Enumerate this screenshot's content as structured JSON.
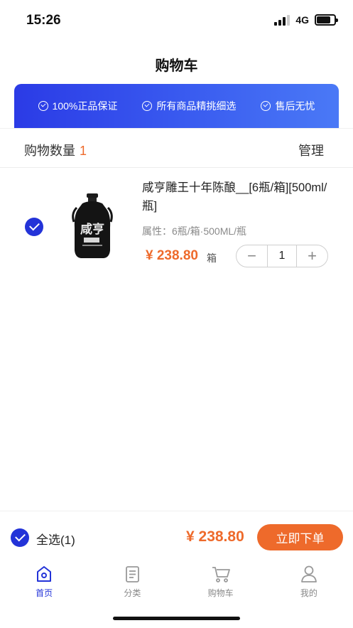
{
  "status_bar": {
    "time": "15:26",
    "network": "4G",
    "battery_level": 0.8
  },
  "header": {
    "title": "购物车"
  },
  "promo": {
    "items": [
      {
        "label": "100%正品保证",
        "icon": "check-circle-icon"
      },
      {
        "label": "所有商品精挑细选",
        "icon": "check-circle-icon"
      },
      {
        "label": "售后无忧",
        "icon": "check-circle-icon"
      }
    ],
    "colors": {
      "start": "#2b3be6",
      "end": "#4a79f6"
    }
  },
  "cart": {
    "count_label": "购物数量",
    "count": "1",
    "manage_label": "管理"
  },
  "items": [
    {
      "selected": true,
      "title": "咸亨雕王十年陈酿__[6瓶/箱][500ml/瓶]",
      "attributes": "属性：6瓶/箱·500ML/瓶",
      "price": "¥ 238.80",
      "unit": "箱",
      "quantity": "1",
      "minus_symbol": "−",
      "plus_symbol": "+",
      "image_lettering": "咸亨"
    }
  ],
  "checkout": {
    "select_all_label": "全选(1)",
    "total": "¥ 238.80",
    "order_button": "立即下单"
  },
  "tabbar": {
    "tabs": [
      {
        "label": "首页",
        "icon": "home-icon",
        "active": true
      },
      {
        "label": "分类",
        "icon": "category-list-icon",
        "active": false
      },
      {
        "label": "购物车",
        "icon": "shopping-cart-icon",
        "active": false
      },
      {
        "label": "我的",
        "icon": "user-icon",
        "active": false
      }
    ]
  },
  "colors": {
    "accent": "#ee6a2b",
    "primary": "#2333d8"
  }
}
